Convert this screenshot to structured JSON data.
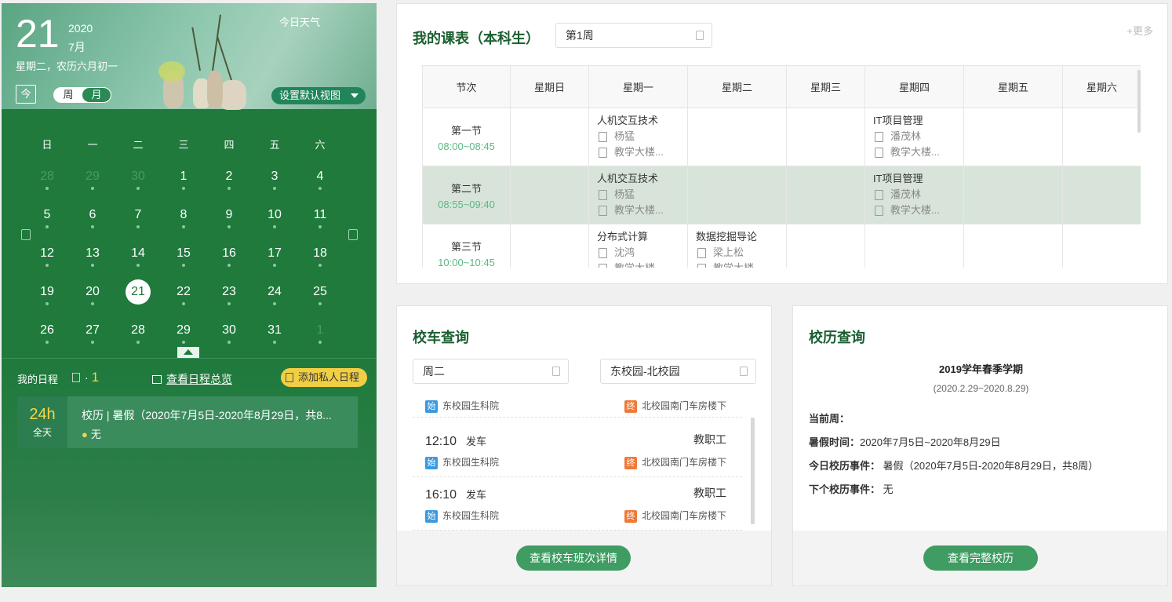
{
  "header": {
    "day": "21",
    "year": "2020",
    "month": "7月",
    "weekday_lunar": "星期二，农历六月初一",
    "weather": "今日天气",
    "today_btn": "今",
    "view_week": "周",
    "view_month": "月",
    "default_view": "设置默认视图"
  },
  "calendar": {
    "weekdays": [
      "日",
      "一",
      "二",
      "三",
      "四",
      "五",
      "六"
    ],
    "weeks": [
      [
        {
          "d": "28",
          "dim": true
        },
        {
          "d": "29",
          "dim": true
        },
        {
          "d": "30",
          "dim": true
        },
        {
          "d": "1"
        },
        {
          "d": "2"
        },
        {
          "d": "3"
        },
        {
          "d": "4"
        }
      ],
      [
        {
          "d": "5"
        },
        {
          "d": "6"
        },
        {
          "d": "7"
        },
        {
          "d": "8"
        },
        {
          "d": "9"
        },
        {
          "d": "10"
        },
        {
          "d": "11"
        }
      ],
      [
        {
          "d": "12"
        },
        {
          "d": "13"
        },
        {
          "d": "14"
        },
        {
          "d": "15"
        },
        {
          "d": "16"
        },
        {
          "d": "17"
        },
        {
          "d": "18"
        }
      ],
      [
        {
          "d": "19"
        },
        {
          "d": "20"
        },
        {
          "d": "21",
          "selected": true
        },
        {
          "d": "22"
        },
        {
          "d": "23"
        },
        {
          "d": "24"
        },
        {
          "d": "25"
        }
      ],
      [
        {
          "d": "26"
        },
        {
          "d": "27"
        },
        {
          "d": "28"
        },
        {
          "d": "29"
        },
        {
          "d": "30"
        },
        {
          "d": "31"
        },
        {
          "d": "1",
          "dim": true
        }
      ]
    ]
  },
  "schedule": {
    "label": "我的日程",
    "count": "1",
    "overview": "查看日程总览",
    "add": "添加私人日程",
    "event": {
      "hours": "24h",
      "allday": "全天",
      "title": "校历 | 暑假（2020年7月5日-2020年8月29日，共8...",
      "place": "无"
    }
  },
  "timetable": {
    "title": "我的课表（本科生）",
    "week_select": "第1周",
    "more": "+更多",
    "headers": [
      "节次",
      "星期日",
      "星期一",
      "星期二",
      "星期三",
      "星期四",
      "星期五",
      "星期六"
    ],
    "rows": [
      {
        "slot": "第一节",
        "time": "08:00~08:45",
        "cells": {
          "1": {
            "name": "人机交互技术",
            "teacher": "杨猛",
            "room": "教学大楼..."
          },
          "4": {
            "name": "IT项目管理",
            "teacher": "潘茂林",
            "room": "教学大楼..."
          }
        }
      },
      {
        "slot": "第二节",
        "time": "08:55~09:40",
        "cells": {
          "1": {
            "name": "人机交互技术",
            "teacher": "杨猛",
            "room": "教学大楼..."
          },
          "4": {
            "name": "IT项目管理",
            "teacher": "潘茂林",
            "room": "教学大楼..."
          }
        }
      },
      {
        "slot": "第三节",
        "time": "10:00~10:45",
        "cells": {
          "1": {
            "name": "分布式计算",
            "teacher": "沈鸿",
            "room": "教学大楼..."
          },
          "2": {
            "name": "数据挖掘导论",
            "teacher": "梁上松",
            "room": "教学大楼..."
          }
        }
      }
    ]
  },
  "bus": {
    "title": "校车查询",
    "day_select": "周二",
    "route_select": "东校园-北校园",
    "start_tag": "始",
    "end_tag": "终",
    "depart": "发车",
    "rows": [
      {
        "time": "",
        "type": "",
        "from": "东校园生科院",
        "to": "北校园南门车房楼下"
      },
      {
        "time": "12:10",
        "type": "教职工",
        "from": "东校园生科院",
        "to": "北校园南门车房楼下"
      },
      {
        "time": "16:10",
        "type": "教职工",
        "from": "东校园生科院",
        "to": "北校园南门车房楼下"
      }
    ],
    "details": "查看校车班次详情"
  },
  "school_calendar": {
    "title": "校历查询",
    "term": "2019学年春季学期",
    "range": "(2020.2.29~2020.8.29)",
    "current_week_label": "当前周：",
    "summer_label": "暑假时间：",
    "summer_value": "2020年7月5日~2020年8月29日",
    "today_label": "今日校历事件：",
    "today_value": "暑假（2020年7月5日-2020年8月29日，共8周）",
    "next_label": "下个校历事件：",
    "next_value": "无",
    "full": "查看完整校历"
  },
  "colors": {
    "brand": "#1f7a3c",
    "accent": "#3f9c62",
    "highlight": "#f1cf45"
  }
}
